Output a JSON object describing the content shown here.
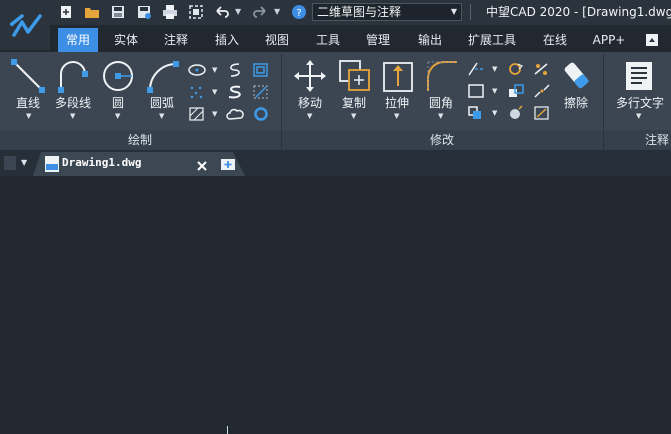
{
  "workspace": {
    "current": "二维草图与注释"
  },
  "app": {
    "title": "中望CAD 2020 - [Drawing1.dwg]"
  },
  "ribbon_tabs": [
    "常用",
    "实体",
    "注释",
    "插入",
    "视图",
    "工具",
    "管理",
    "输出",
    "扩展工具",
    "在线",
    "APP+"
  ],
  "draw": {
    "panel_title": "绘制",
    "line": "直线",
    "polyline": "多段线",
    "circle": "圆",
    "arc": "圆弧"
  },
  "modify": {
    "panel_title": "修改",
    "move": "移动",
    "copy": "复制",
    "stretch": "拉伸",
    "fillet": "圆角",
    "erase": "擦除"
  },
  "annotation": {
    "panel_title": "注释",
    "mtext": "多行文字"
  },
  "document": {
    "tab_name": "Drawing1.dwg"
  },
  "colors": {
    "accent": "#3d8ee5",
    "ribbon_bg": "#3b4652",
    "canvas_bg": "#212830"
  }
}
